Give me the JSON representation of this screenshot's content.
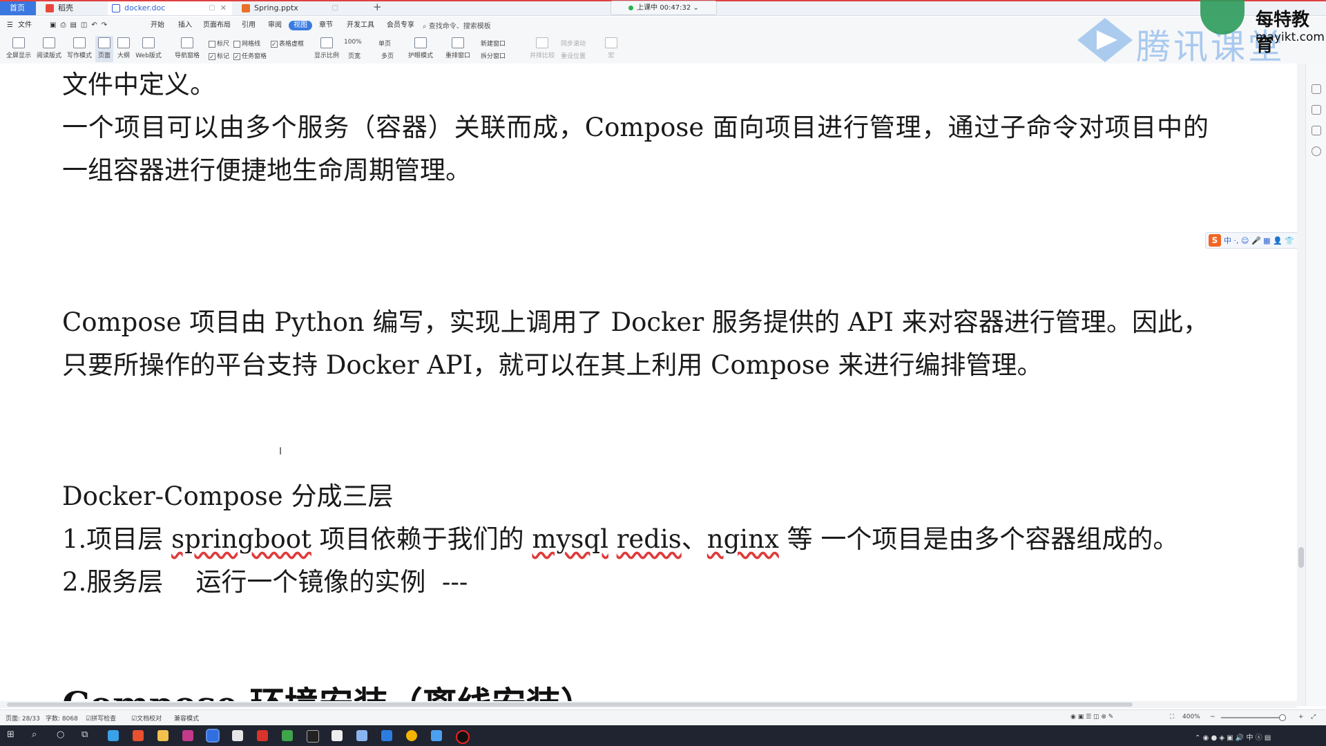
{
  "tabs": {
    "home": "首页",
    "wps": "稻壳",
    "doc": "docker.doc",
    "ppt": "Spring.pptx"
  },
  "recording": {
    "label": "上课中 00:47:32"
  },
  "menu": {
    "file": "文件",
    "items": [
      "开始",
      "插入",
      "页面布局",
      "引用",
      "审阅",
      "视图",
      "章节",
      "开发工具",
      "会员专享"
    ],
    "search": "查找命令、搜索模板"
  },
  "toolbar": {
    "fullscreen": "全屏显示",
    "read_mode": "阅读版式",
    "write_mode": "写作模式",
    "page": "页面",
    "outline": "大纲",
    "web": "Web版式",
    "nav_pane": "导航窗格",
    "ruler": "标尺",
    "gridlines": "网格线",
    "table_lines": "表格虚框",
    "marks": "标记",
    "task_pane": "任务窗格",
    "zoom_ratio": "显示比例",
    "zoom_100": "100%",
    "single_page": "单页",
    "page_width": "页宽",
    "multi_page": "多页",
    "eye_mode": "护眼模式",
    "rearrange": "重排窗口",
    "new_window": "新建窗口",
    "split_window": "拆分窗口",
    "side_by_side": "并排比较",
    "sync_scroll": "同步滚动",
    "reset_position": "重设位置",
    "macro": "宏"
  },
  "logos": {
    "tencent": "腾讯课堂",
    "mayikt_name": "每特教育",
    "mayikt_url": "mayikt.com"
  },
  "document": {
    "line1": "文件中定义。",
    "para2": "一个项目可以由多个服务（容器）关联而成，Compose 面向项目进行管理，通过子命令对项目中的一组容器进行便捷地生命周期管理。",
    "para3": "Compose 项目由 Python 编写，实现上调用了 Docker 服务提供的 API 来对容器进行管理。因此，只要所操作的平台支持 Docker API，就可以在其上利用 Compose 来进行编排管理。",
    "layers_title": "Docker-Compose 分成三层",
    "layer1_prefix": "1.项目层  ",
    "layer1_springboot": "springboot",
    "layer1_mid": " 项目依赖于我们的 ",
    "layer1_mysql": "mysql",
    "layer1_space": " ",
    "layer1_redis": "redis",
    "layer1_sep": "、",
    "layer1_nginx": "nginx",
    "layer1_suffix": " 等  一个项目是由多个容器组成的。",
    "layer2": "2.服务层    运行一个镜像的实例  ---",
    "heading_partial": "Compose 环境安装（离线安装）"
  },
  "ime": {
    "label": "中 ·, ☺ 🎤 ▦ 👤 👕 ⊞"
  },
  "statusbar": {
    "page": "页面: 28/33",
    "words": "字数: 8068",
    "spell": "拼写检查",
    "proof": "文档校对",
    "compat": "兼容模式",
    "zoom": "400%"
  }
}
